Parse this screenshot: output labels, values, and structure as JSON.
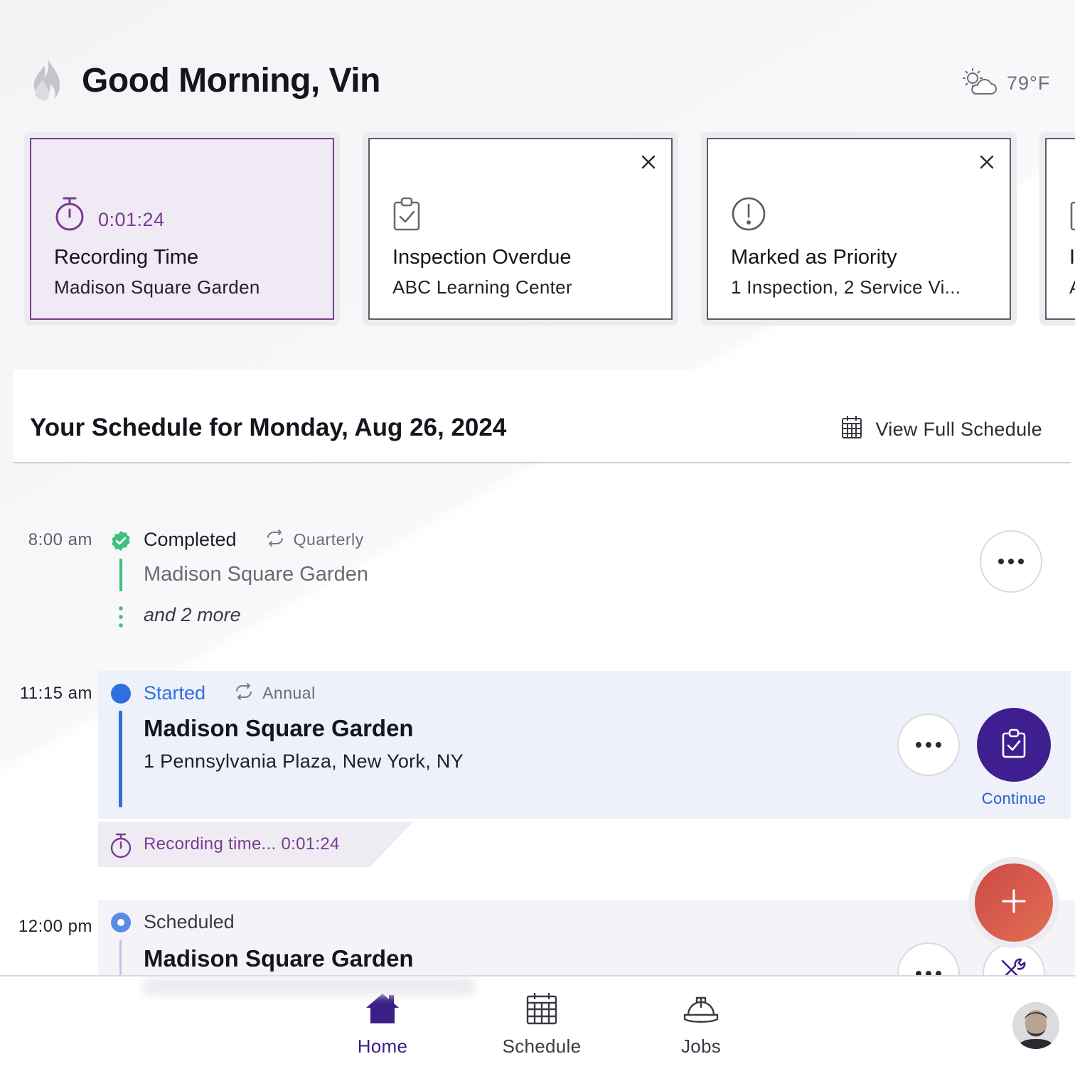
{
  "header": {
    "greeting": "Good Morning, Vin",
    "weather": {
      "temperature": "79°F",
      "icon": "partly-cloudy-icon"
    }
  },
  "cards": [
    {
      "icon": "stopwatch-icon",
      "timer": "0:01:24",
      "title": "Recording Time",
      "subtitle": "Madison Square Garden",
      "active": true,
      "closable": false
    },
    {
      "icon": "clipboard-check-icon",
      "title": "Inspection Overdue",
      "subtitle": "ABC Learning Center",
      "active": false,
      "closable": true
    },
    {
      "icon": "alert-circle-icon",
      "title": "Marked as Priority",
      "subtitle": "1 Inspection, 2 Service Vi...",
      "active": false,
      "closable": true
    },
    {
      "icon": "clipboard-check-icon",
      "title": "I",
      "subtitle": "A",
      "active": false,
      "closable": false
    }
  ],
  "schedule": {
    "title": "Your Schedule for Monday, Aug 26, 2024",
    "view_full_label": "View Full Schedule",
    "entries": [
      {
        "time": "8:00 am",
        "status": "Completed",
        "recurrence": "Quarterly",
        "location": "Madison Square Garden",
        "more": "and 2 more",
        "status_color": "#3fbf7f"
      },
      {
        "time": "11:15 am",
        "status": "Started",
        "recurrence": "Annual",
        "location": "Madison Square Garden",
        "address": "1 Pennsylvania Plaza, New York, NY",
        "action_label": "Continue",
        "recording_label": "Recording time...",
        "recording_time": "0:01:24",
        "status_color": "#2f6fe0"
      },
      {
        "time": "12:00 pm",
        "status": "Scheduled",
        "location": "Madison Square Garden",
        "status_color": "#5b8be8"
      }
    ]
  },
  "nav": {
    "items": [
      {
        "label": "Home",
        "icon": "home-icon",
        "active": true
      },
      {
        "label": "Schedule",
        "icon": "calendar-icon",
        "active": false
      },
      {
        "label": "Jobs",
        "icon": "hard-hat-icon",
        "active": false
      }
    ]
  },
  "colors": {
    "brand": "#3f1f8f",
    "recording": "#7b3a93",
    "fab": "#d95a4e",
    "started": "#2f6fe0",
    "completed": "#3fbf7f"
  }
}
